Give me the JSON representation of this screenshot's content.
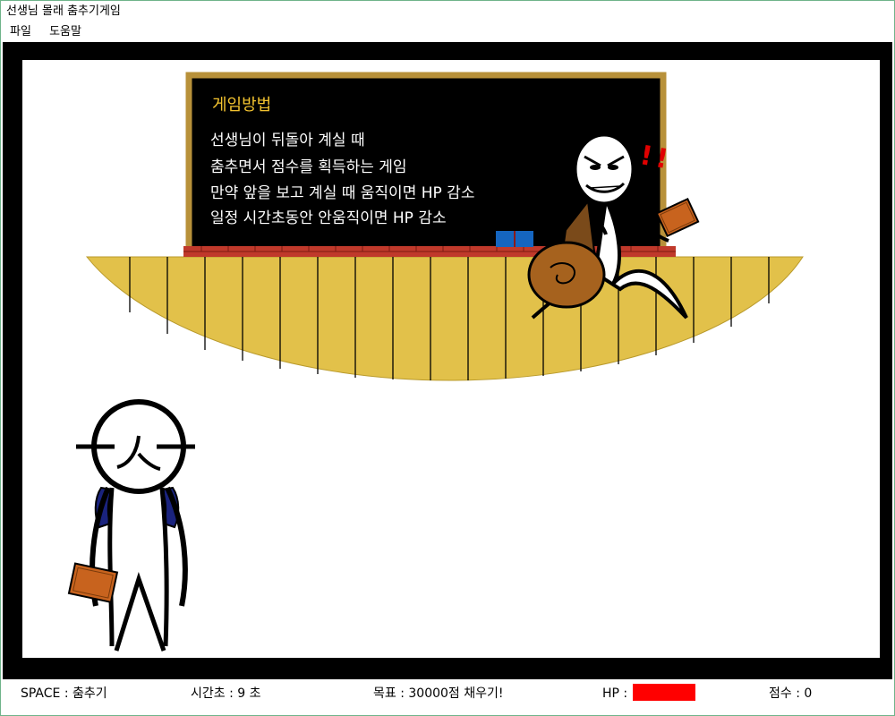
{
  "window": {
    "title": "선생님 몰래 춤추기게임"
  },
  "menu": {
    "items": [
      "파일",
      "도움말"
    ]
  },
  "board": {
    "title": "게임방법",
    "lines": [
      "선생님이 뒤돌아 계실 때",
      "춤추면서 점수를 획득하는 게임",
      "만약 앞을 보고 계실 때 움직이면 HP 감소",
      "일정 시간초동안 안움직이면 HP 감소"
    ]
  },
  "teacher": {
    "alert": "!!"
  },
  "status": {
    "space_label": "SPACE : 춤추기",
    "time_label": "시간초 : 9  초",
    "goal_label": "목표 : 30000점 채우기!",
    "hp_label": "HP :",
    "hp_fraction": 1.0,
    "score_label": "점수 : 0"
  },
  "colors": {
    "hp": "#ff0000",
    "stage": "#e2c14a",
    "board": "#000000",
    "board_frame": "#b8913a",
    "brick": "#c0392b"
  }
}
